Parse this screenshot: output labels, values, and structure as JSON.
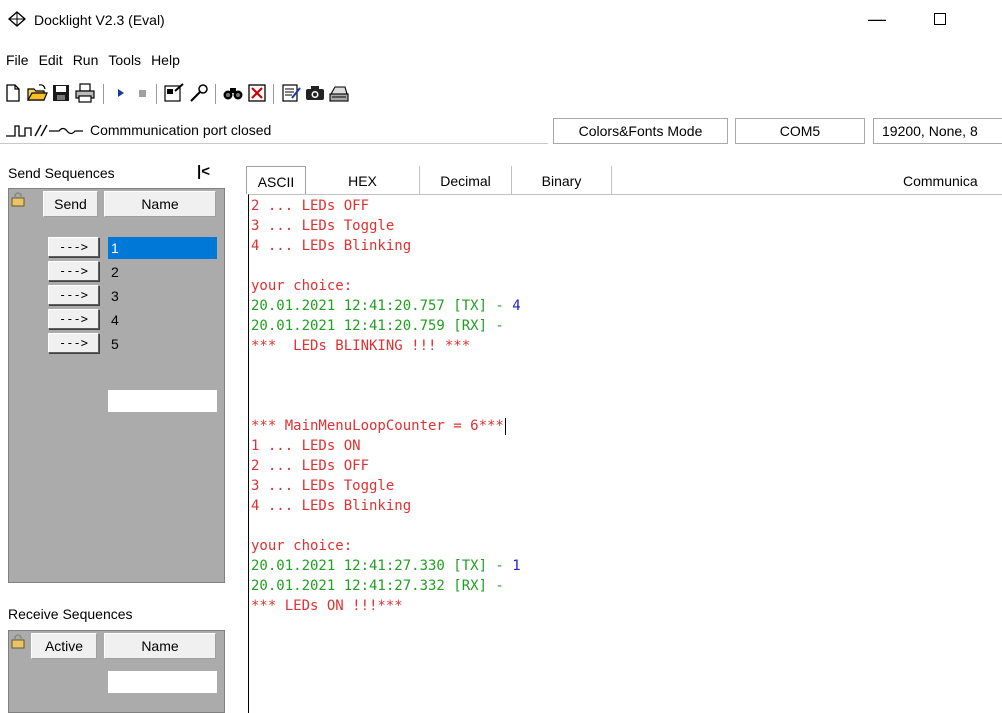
{
  "window": {
    "title": "Docklight V2.3 (Eval)",
    "minimize_glyph": "—"
  },
  "menu": [
    "File",
    "Edit",
    "Run",
    "Tools",
    "Help"
  ],
  "toolbar": {
    "icons": [
      "new-icon",
      "open-icon",
      "save-icon",
      "print-icon",
      "run-icon",
      "stop-icon",
      "settings-icon",
      "keyboard-icon",
      "find-icon",
      "clear-icon",
      "notepad-icon",
      "snapshot-icon",
      "keyboard-console-icon"
    ]
  },
  "status": {
    "port_text": "Commmunication port closed",
    "mode": "Colors&Fonts Mode",
    "port": "COM5",
    "settings": "19200, None, 8"
  },
  "send_sequences": {
    "title": "Send Sequences",
    "collapse": "|<",
    "col_send": "Send",
    "col_name": "Name",
    "button_label": "--->",
    "rows": [
      "1",
      "2",
      "3",
      "4",
      "5"
    ],
    "selected_index": 0
  },
  "receive_sequences": {
    "title": "Receive Sequences",
    "col_active": "Active",
    "col_name": "Name"
  },
  "tabs": [
    "ASCII",
    "HEX",
    "Decimal",
    "Binary"
  ],
  "active_tab": "ASCII",
  "comm_label": "Communica",
  "log": [
    {
      "color": "red",
      "text": "2 ... LEDs OFF"
    },
    {
      "color": "red",
      "text": "3 ... LEDs Toggle"
    },
    {
      "color": "red",
      "text": "4 ... LEDs Blinking"
    },
    {
      "color": "red",
      "text": ""
    },
    {
      "color": "red",
      "text": "your choice:"
    },
    {
      "color": "green",
      "text": "20.01.2021 12:41:20.757 [TX] - ",
      "suffix": "4",
      "suffix_color": "blue"
    },
    {
      "color": "green",
      "text": "20.01.2021 12:41:20.759 [RX] - "
    },
    {
      "color": "red",
      "text": "***  LEDs BLINKING !!! ***"
    },
    {
      "color": "red",
      "text": ""
    },
    {
      "color": "red",
      "text": ""
    },
    {
      "color": "red",
      "text": ""
    },
    {
      "color": "red",
      "text": "*** MainMenuLoopCounter = 6***",
      "caret": true
    },
    {
      "color": "red",
      "text": "1 ... LEDs ON"
    },
    {
      "color": "red",
      "text": "2 ... LEDs OFF"
    },
    {
      "color": "red",
      "text": "3 ... LEDs Toggle"
    },
    {
      "color": "red",
      "text": "4 ... LEDs Blinking"
    },
    {
      "color": "red",
      "text": ""
    },
    {
      "color": "red",
      "text": "your choice:"
    },
    {
      "color": "green",
      "text": "20.01.2021 12:41:27.330 [TX] - ",
      "suffix": "1",
      "suffix_color": "blue"
    },
    {
      "color": "green",
      "text": "20.01.2021 12:41:27.332 [RX] - "
    },
    {
      "color": "red",
      "text": "*** LEDs ON !!!***"
    }
  ],
  "colors": {
    "red": "#e03030",
    "green": "#20a020",
    "blue": "#2020d0",
    "selection": "#0078d7",
    "grid_bg": "#ababab"
  }
}
